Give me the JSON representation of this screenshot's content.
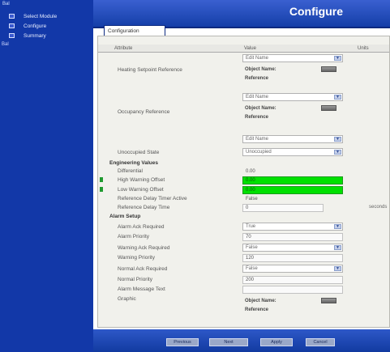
{
  "brand": "Bal",
  "sidebar": {
    "items": [
      {
        "label": "Select Module",
        "icon": "module-icon"
      },
      {
        "label": "Configure",
        "icon": "configure-icon"
      },
      {
        "label": "Summary",
        "icon": "summary-icon"
      }
    ],
    "last_label": "Bal"
  },
  "header": {
    "title": "Configure"
  },
  "tab": {
    "label": "Configuration"
  },
  "table": {
    "columns": [
      "Attribute",
      "Value",
      "Units"
    ]
  },
  "rows": {
    "heating_ref": {
      "label": "Heating Setpoint Reference",
      "mode": "Edit Name",
      "object_label": "Object Name:",
      "ref_label": "Reference"
    },
    "occupancy_ref": {
      "label": "Occupancy Reference",
      "mode": "Edit Name",
      "object_label": "Object Name:",
      "ref_label": "Reference"
    },
    "extra_mode": "Edit Name",
    "unoccupied_state": {
      "label": "Unoccupied State",
      "value": "Unoccupied"
    },
    "engineering": {
      "title": "Engineering Values",
      "differential": {
        "label": "Differential",
        "value": "0.00"
      },
      "high_warning": {
        "label": "High Warning Offset",
        "value": "0.00"
      },
      "low_warning": {
        "label": "Low Warning Offset",
        "value": "0.00"
      },
      "ref_delay_active": {
        "label": "Reference Delay Timer Active",
        "value": "False"
      },
      "ref_delay_time": {
        "label": "Reference Delay Time",
        "value": "0",
        "units": "seconds"
      }
    },
    "alarm": {
      "title": "Alarm Setup",
      "ack_required": {
        "label": "Alarm Ack Required",
        "value": "True"
      },
      "priority": {
        "label": "Alarm Priority",
        "value": "70"
      },
      "warning_ack": {
        "label": "Warning Ack Required",
        "value": "False"
      },
      "warning_priority": {
        "label": "Warning Priority",
        "value": "120"
      },
      "normal_ack": {
        "label": "Normal Ack Required",
        "value": "False"
      },
      "normal_priority": {
        "label": "Normal Priority",
        "value": "200"
      },
      "message_text": {
        "label": "Alarm Message Text",
        "value": ""
      },
      "graphic": {
        "label": "Graphic",
        "object_label": "Object Name:",
        "ref_label": "Reference"
      }
    }
  },
  "buttons": [
    "Previous",
    "Next",
    "Apply",
    "Cancel"
  ]
}
